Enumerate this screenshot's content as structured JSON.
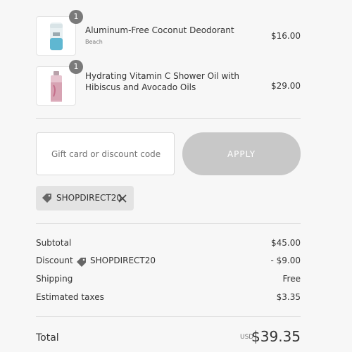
{
  "items": [
    {
      "quantity": "1",
      "name": "Aluminum-Free Coconut Deodorant",
      "variant": "Beach",
      "price": "$16.00",
      "thumb_colors": [
        "#5fb7d1",
        "#e3eef1"
      ]
    },
    {
      "quantity": "1",
      "name": "Hydrating Vitamin C Shower Oil with Hibiscus and Avocado Oils",
      "variant": "",
      "price": "$29.00",
      "thumb_colors": [
        "#d7a3b3",
        "#c56f8b"
      ]
    }
  ],
  "discount": {
    "placeholder": "Gift card or discount code",
    "apply_label": "APPLY",
    "applied_code": "SHOPDIRECT20"
  },
  "summary": {
    "subtotal_label": "Subtotal",
    "subtotal_value": "$45.00",
    "discount_label": "Discount",
    "discount_code": "SHOPDIRECT20",
    "discount_value": "- $9.00",
    "shipping_label": "Shipping",
    "shipping_value": "Free",
    "taxes_label": "Estimated taxes",
    "taxes_value": "$3.35"
  },
  "total": {
    "label": "Total",
    "currency": "USD",
    "value": "$39.35"
  },
  "colors": {
    "background": "#f7f7f7",
    "button_disabled": "#c8c8c8",
    "chip": "#e3e3e3",
    "quantity_badge": "#7a7a7a"
  }
}
